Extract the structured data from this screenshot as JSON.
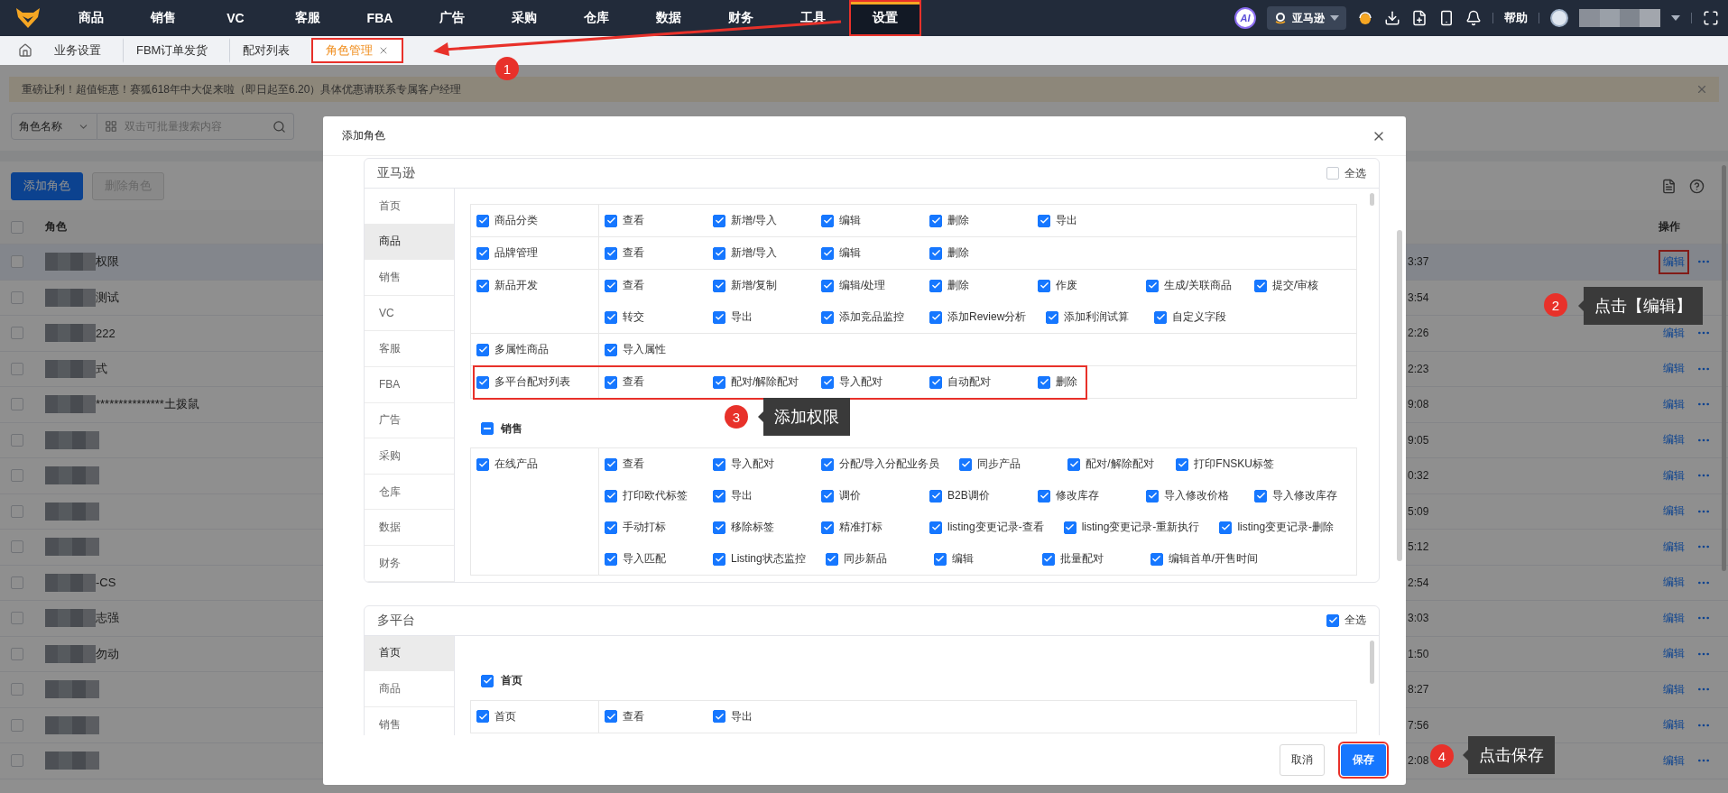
{
  "top_nav": {
    "items": [
      {
        "label": "商品",
        "selected": false,
        "annotated": false
      },
      {
        "label": "销售",
        "selected": false,
        "annotated": false
      },
      {
        "label": "VC",
        "selected": false,
        "annotated": false
      },
      {
        "label": "客服",
        "selected": false,
        "annotated": false
      },
      {
        "label": "FBA",
        "selected": false,
        "annotated": false
      },
      {
        "label": "广告",
        "selected": false,
        "annotated": false
      },
      {
        "label": "采购",
        "selected": false,
        "annotated": false
      },
      {
        "label": "仓库",
        "selected": false,
        "annotated": false
      },
      {
        "label": "数据",
        "selected": false,
        "annotated": false
      },
      {
        "label": "财务",
        "selected": false,
        "annotated": false
      },
      {
        "label": "工具",
        "selected": false,
        "annotated": false
      },
      {
        "label": "设置",
        "selected": true,
        "annotated": true
      }
    ],
    "ai_badge": "AI",
    "store_selector": "亚马逊",
    "help": "帮助"
  },
  "tabs": [
    {
      "label": "业务设置",
      "selected": false,
      "annotated": false
    },
    {
      "label": "FBM订单发货",
      "selected": false,
      "annotated": false
    },
    {
      "label": "配对列表",
      "selected": false,
      "annotated": false
    },
    {
      "label": "角色管理",
      "selected": true,
      "annotated": true
    }
  ],
  "banner": {
    "text": "重磅让利！超值钜惠！赛狐618年中大促来啦（即日起至6.20）具体优惠请联系专属客户经理"
  },
  "filter": {
    "field": "角色名称",
    "placeholder": "双击可批量搜索内容"
  },
  "actions": [
    {
      "label": "添加角色",
      "kind": "primary"
    },
    {
      "label": "删除角色",
      "kind": "disabled"
    }
  ],
  "table": {
    "columns": [
      "角色",
      "操作"
    ],
    "all_checked": false,
    "rows": [
      {
        "name": "权限",
        "time": "3:37",
        "checked": false,
        "highlighted": true,
        "action": "编辑",
        "annotated": true
      },
      {
        "name": "测试",
        "time": "3:54",
        "checked": false,
        "highlighted": false
      },
      {
        "name": "222",
        "time": "2:26",
        "checked": false,
        "highlighted": false,
        "action": "编辑",
        "annotated": false
      },
      {
        "name": "式",
        "time": "2:23",
        "checked": false,
        "highlighted": false,
        "action": "编辑",
        "annotated": false
      },
      {
        "name": "***************土拨鼠",
        "time": "9:08",
        "checked": false,
        "highlighted": false,
        "action": "编辑",
        "annotated": false
      },
      {
        "time": "9:05",
        "checked": false,
        "highlighted": false,
        "action": "编辑",
        "annotated": false
      },
      {
        "time": "0:32",
        "checked": false,
        "highlighted": false,
        "action": "编辑",
        "annotated": false
      },
      {
        "time": "5:09",
        "checked": false,
        "highlighted": false,
        "action": "编辑",
        "annotated": false
      },
      {
        "time": "5:12",
        "checked": false,
        "highlighted": false,
        "action": "编辑",
        "annotated": false
      },
      {
        "name": "-CS",
        "time": "2:54",
        "checked": false,
        "highlighted": false,
        "action": "编辑",
        "annotated": false
      },
      {
        "name": "志强",
        "time": "3:03",
        "checked": false,
        "highlighted": false,
        "action": "编辑",
        "annotated": false
      },
      {
        "name": "勿动",
        "time": "1:50",
        "checked": false,
        "highlighted": false,
        "action": "编辑",
        "annotated": false
      },
      {
        "time": "8:27",
        "checked": false,
        "highlighted": false,
        "action": "编辑",
        "annotated": false
      },
      {
        "time": "7:56",
        "checked": false,
        "highlighted": false,
        "action": "编辑",
        "annotated": false
      },
      {
        "time": "2:08",
        "checked": false,
        "highlighted": false,
        "action": "编辑",
        "annotated": false
      }
    ]
  },
  "modal": {
    "title": "添加角色",
    "sections": [
      {
        "title": "亚马逊",
        "select_all": "全选",
        "all_checked": false,
        "nav": [
          {
            "label": "首页",
            "selected": false
          },
          {
            "label": "商品",
            "selected": true
          },
          {
            "label": "销售",
            "selected": false
          },
          {
            "label": "VC",
            "selected": false
          },
          {
            "label": "客服",
            "selected": false
          },
          {
            "label": "FBA",
            "selected": false
          },
          {
            "label": "广告",
            "selected": false
          },
          {
            "label": "采购",
            "selected": false
          },
          {
            "label": "仓库",
            "selected": false
          },
          {
            "label": "数据",
            "selected": false
          },
          {
            "label": "财务",
            "selected": false
          }
        ],
        "groups": [
          {
            "rows": [
              {
                "module": "商品分类",
                "checked": true,
                "permissions": [
                  {
                    "label": "查看",
                    "checked": true
                  },
                  {
                    "label": "新增/导入",
                    "checked": true
                  },
                  {
                    "label": "编辑",
                    "checked": true
                  },
                  {
                    "label": "删除",
                    "checked": true
                  },
                  {
                    "label": "导出",
                    "checked": true
                  }
                ]
              },
              {
                "module": "品牌管理",
                "checked": true,
                "permissions": [
                  {
                    "label": "查看",
                    "checked": true
                  },
                  {
                    "label": "新增/导入",
                    "checked": true
                  },
                  {
                    "label": "编辑",
                    "checked": true
                  },
                  {
                    "label": "删除",
                    "checked": true
                  }
                ]
              },
              {
                "module": "新品开发",
                "checked": true,
                "permissions": [
                  {
                    "label": "查看",
                    "checked": true
                  },
                  {
                    "label": "新增/复制",
                    "checked": true
                  },
                  {
                    "label": "编辑/处理",
                    "checked": true
                  },
                  {
                    "label": "删除",
                    "checked": true
                  },
                  {
                    "label": "作废",
                    "checked": true
                  },
                  {
                    "label": "生成/关联商品",
                    "checked": true
                  },
                  {
                    "label": "提交/审核",
                    "checked": true
                  },
                  {
                    "label": "转交",
                    "checked": true
                  },
                  {
                    "label": "导出",
                    "checked": true
                  },
                  {
                    "label": "添加竞品监控",
                    "checked": true
                  },
                  {
                    "label": "添加Review分析",
                    "checked": true
                  },
                  {
                    "label": "添加利润试算",
                    "checked": true
                  },
                  {
                    "label": "自定义字段",
                    "checked": true
                  }
                ]
              },
              {
                "module": "多属性商品",
                "checked": true,
                "permissions": [
                  {
                    "label": "导入属性",
                    "checked": true
                  }
                ]
              },
              {
                "module": "多平台配对列表",
                "checked": true,
                "annotated": true,
                "permissions": [
                  {
                    "label": "查看",
                    "checked": true
                  },
                  {
                    "label": "配对/解除配对",
                    "checked": true
                  },
                  {
                    "label": "导入配对",
                    "checked": true
                  },
                  {
                    "label": "自动配对",
                    "checked": true
                  },
                  {
                    "label": "删除",
                    "checked": true
                  }
                ]
              }
            ]
          },
          {
            "title": "销售",
            "indeterminate": true,
            "rows": [
              {
                "module": "在线产品",
                "checked": true,
                "permissions": [
                  {
                    "label": "查看",
                    "checked": true
                  },
                  {
                    "label": "导入配对",
                    "checked": true
                  },
                  {
                    "label": "分配/导入分配业务员",
                    "checked": true
                  },
                  {
                    "label": "同步产品",
                    "checked": true
                  },
                  {
                    "label": "配对/解除配对",
                    "checked": true
                  },
                  {
                    "label": "打印FNSKU标签",
                    "checked": true
                  },
                  {
                    "label": "打印欧代标签",
                    "checked": true
                  },
                  {
                    "label": "导出",
                    "checked": true
                  },
                  {
                    "label": "调价",
                    "checked": true
                  },
                  {
                    "label": "B2B调价",
                    "checked": true
                  },
                  {
                    "label": "修改库存",
                    "checked": true
                  },
                  {
                    "label": "导入修改价格",
                    "checked": true
                  },
                  {
                    "label": "导入修改库存",
                    "checked": true
                  },
                  {
                    "label": "手动打标",
                    "checked": true
                  },
                  {
                    "label": "移除标签",
                    "checked": true
                  },
                  {
                    "label": "精准打标",
                    "checked": true
                  },
                  {
                    "label": "listing变更记录-查看",
                    "checked": true
                  },
                  {
                    "label": "listing变更记录-重新执行",
                    "checked": true
                  },
                  {
                    "label": "listing变更记录-删除",
                    "checked": true
                  },
                  {
                    "label": "导入匹配",
                    "checked": true
                  },
                  {
                    "label": "Listing状态监控",
                    "checked": true
                  },
                  {
                    "label": "同步新品",
                    "checked": true
                  },
                  {
                    "label": "编辑",
                    "checked": true
                  },
                  {
                    "label": "批量配对",
                    "checked": true
                  },
                  {
                    "label": "编辑首单/开售时间",
                    "checked": true
                  }
                ]
              }
            ]
          }
        ]
      },
      {
        "title": "多平台",
        "select_all": "全选",
        "all_checked": true,
        "nav": [
          {
            "label": "首页",
            "selected": true
          },
          {
            "label": "商品",
            "selected": false
          },
          {
            "label": "销售",
            "selected": false
          }
        ],
        "groups": [
          {
            "title": "首页",
            "checked": true,
            "rows": [
              {
                "module": "首页",
                "checked": true,
                "permissions": [
                  {
                    "label": "查看",
                    "checked": true
                  },
                  {
                    "label": "导出",
                    "checked": true
                  }
                ]
              }
            ]
          }
        ]
      }
    ],
    "buttons": [
      {
        "label": "取消",
        "kind": "default",
        "annotated": false
      },
      {
        "label": "保存",
        "kind": "primary",
        "annotated": true
      }
    ]
  },
  "annotations": [
    {
      "number": "1",
      "kind": "arrow"
    },
    {
      "number": "2",
      "kind": "callout",
      "text": "点击【编辑】"
    },
    {
      "number": "3",
      "kind": "callout",
      "text": "添加权限"
    },
    {
      "number": "4",
      "kind": "callout",
      "text": "点击保存"
    }
  ]
}
